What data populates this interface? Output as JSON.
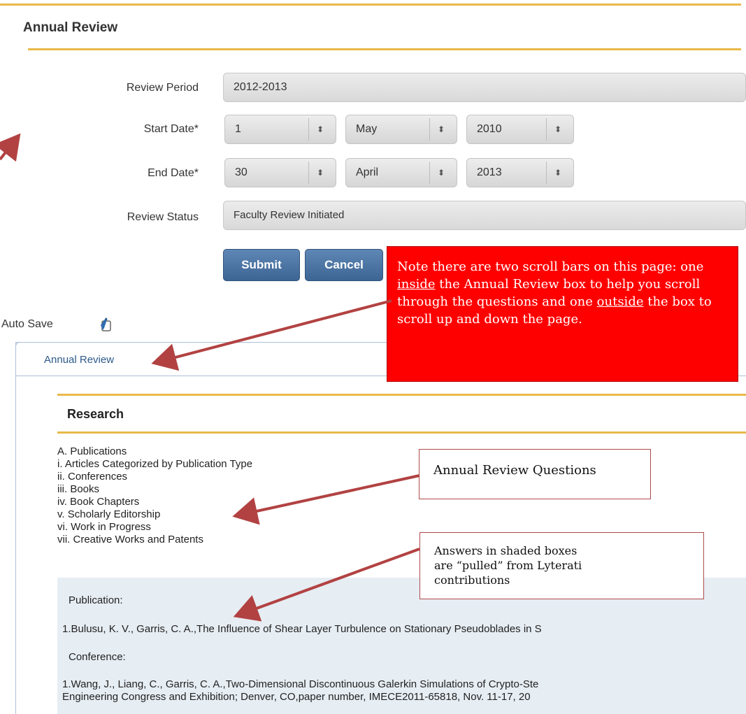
{
  "header": {
    "title": "Annual Review"
  },
  "form": {
    "review_period_label": "Review Period",
    "review_period_value": "2012-2013",
    "start_date_label": "Start Date*",
    "start_day": "1",
    "start_month": "May",
    "start_year": "2010",
    "end_date_label": "End Date*",
    "end_day": "30",
    "end_month": "April",
    "end_year": "2013",
    "review_status_label": "Review Status",
    "review_status_value": "Faculty Review Initiated",
    "submit_label": "Submit",
    "cancel_label": "Cancel"
  },
  "autosave": {
    "label": "Auto Save"
  },
  "panel": {
    "tab_label": "Annual Review",
    "section_title": "Research",
    "questions": [
      "A. Publications",
      "i. Articles Categorized by Publication Type",
      "ii. Conferences",
      "iii. Books",
      "iv. Book Chapters",
      "v. Scholarly Editorship",
      "vi. Work in Progress",
      "vii. Creative Works and Patents"
    ],
    "answers": {
      "publication_label": "Publication:",
      "publication_1": "1.Bulusu, K. V., Garris, C. A.,The Influence of Shear Layer Turbulence on Stationary Pseudoblades in S",
      "conference_label": "Conference:",
      "conference_1_line1": "1.Wang, J., Liang, C., Garris, C. A.,Two-Dimensional Discontinuous Galerkin Simulations of Crypto-Ste",
      "conference_1_line2": "Engineering Congress and Exhibition; Denver, CO,paper number, IMECE2011-65818, Nov. 11-17, 20"
    }
  },
  "annotations": {
    "note_p1": "Note there are two scroll bars on this page: one ",
    "note_inside": "inside",
    "note_p2": " the Annual Review box to help you scroll through the questions and one ",
    "note_outside": "outside",
    "note_p3": " the box to scroll up and down the page.",
    "questions_callout": "Annual Review Questions",
    "answers_callout": "Answers in shaded boxes are “pulled” from Lyterati contributions"
  },
  "colors": {
    "accent_gold": "#e9b94a",
    "button_blue": "#4a72a2",
    "note_red": "#ff0000",
    "arrow_red": "#b24242",
    "answer_bg": "#e6edf3"
  }
}
